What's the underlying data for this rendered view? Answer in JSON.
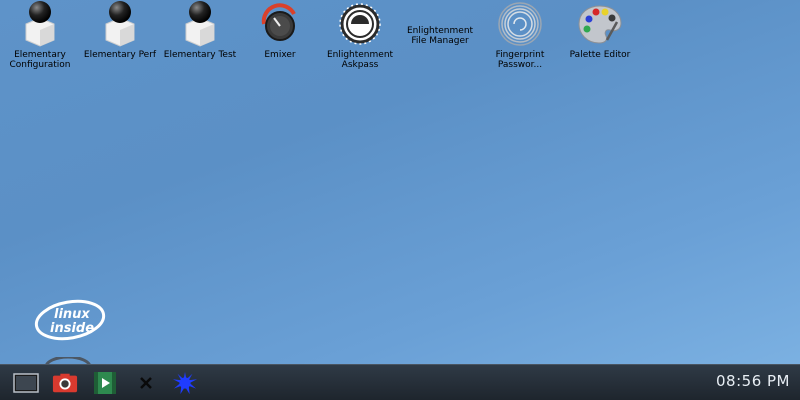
{
  "desktop_icons": [
    {
      "name": "elementary-configuration",
      "label": "Elementary\nConfiguration",
      "icon": "elementary-ball-icon"
    },
    {
      "name": "elementary-perf",
      "label": "Elementary Perf",
      "icon": "elementary-ball-icon"
    },
    {
      "name": "elementary-test",
      "label": "Elementary Test",
      "icon": "elementary-ball-icon"
    },
    {
      "name": "emixer",
      "label": "Emixer",
      "icon": "volume-knob-icon"
    },
    {
      "name": "enlightenment-askpass",
      "label": "Enlightenment\nAskpass",
      "icon": "enlightenment-icon"
    },
    {
      "name": "enlightenment-file-manager",
      "label": "Enlightenment\nFile Manager",
      "icon": "none"
    },
    {
      "name": "fingerprint-password",
      "label": "Fingerprint\nPasswor...",
      "icon": "fingerprint-icon"
    },
    {
      "name": "palette-editor",
      "label": "Palette Editor",
      "icon": "palette-icon"
    }
  ],
  "desktop_logo": {
    "line1": "linux",
    "line2": "inside"
  },
  "taskbar": {
    "items": [
      {
        "name": "terminal-launcher",
        "icon": "terminal-icon"
      },
      {
        "name": "screenshot-launcher",
        "icon": "camera-icon"
      },
      {
        "name": "media-player-launcher",
        "icon": "video-player-icon"
      },
      {
        "name": "close-launcher",
        "icon": "close-icon"
      },
      {
        "name": "enlightenment-launcher",
        "icon": "splat-icon"
      }
    ],
    "clock": "08:56 PM"
  },
  "colors": {
    "desktop_top": "#5e93c9",
    "desktop_bottom": "#7fb4e4",
    "taskbar": "#262f39",
    "clock_text": "#e8eef4",
    "splat": "#1f3cff"
  }
}
